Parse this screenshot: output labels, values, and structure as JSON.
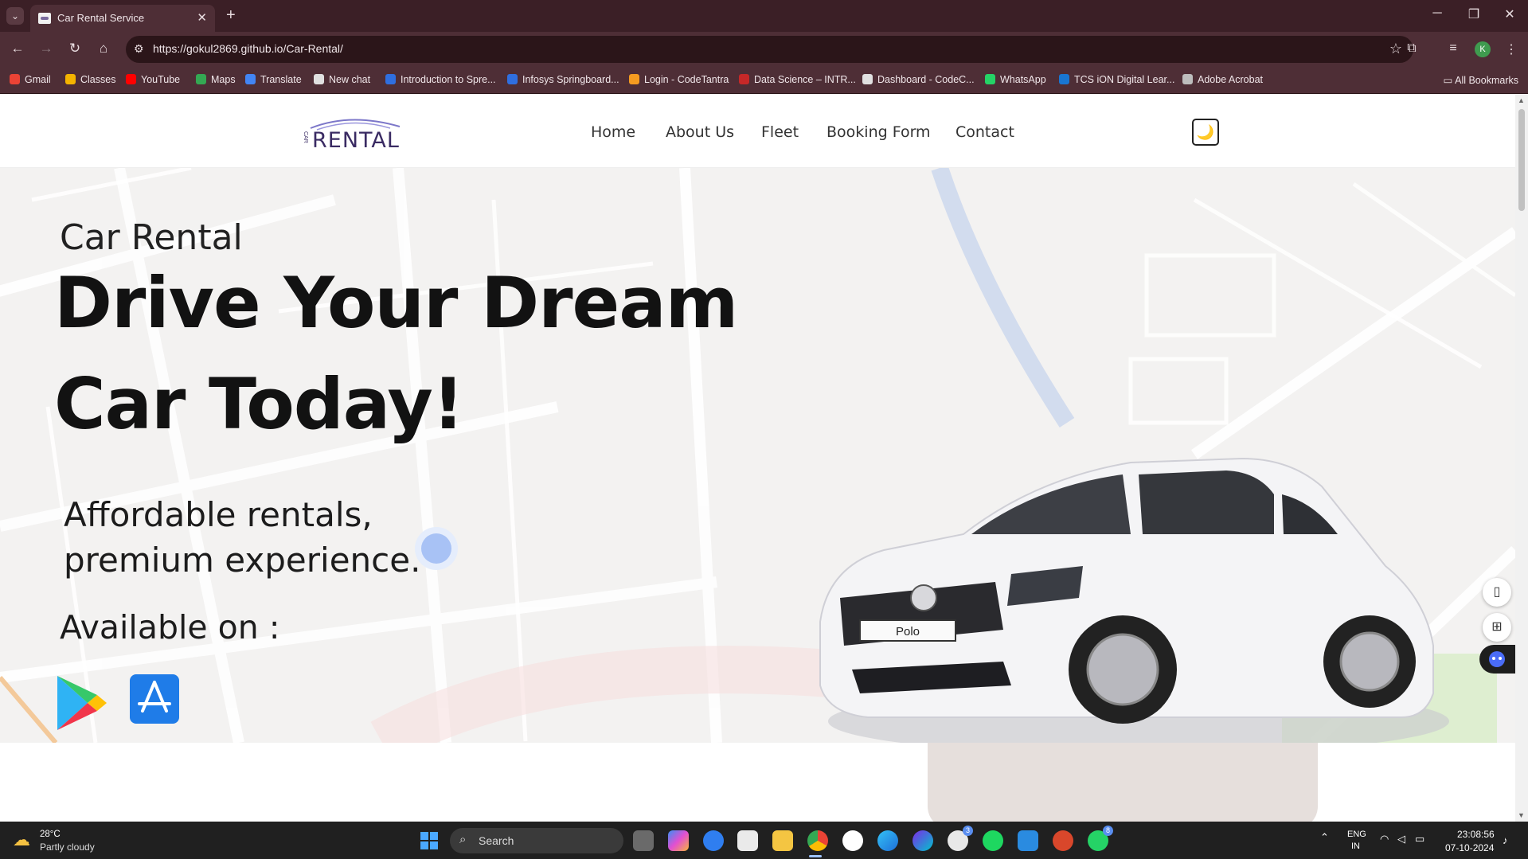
{
  "browser": {
    "tab_title": "Car Rental Service",
    "url": "https://gokul2869.github.io/Car-Rental/",
    "profile_initial": "K",
    "bookmarks": [
      {
        "label": "Gmail",
        "color": "#ea4335"
      },
      {
        "label": "Classes",
        "color": "#f4b400"
      },
      {
        "label": "YouTube",
        "color": "#ff0000"
      },
      {
        "label": "Maps",
        "color": "#34a853"
      },
      {
        "label": "Translate",
        "color": "#4285f4"
      },
      {
        "label": "New chat",
        "color": "#e0e0e0"
      },
      {
        "label": "Introduction to Spre...",
        "color": "#2f6fe0"
      },
      {
        "label": "Infosys Springboard...",
        "color": "#2f6fe0"
      },
      {
        "label": "Login - CodeTantra",
        "color": "#f59b20"
      },
      {
        "label": "Data Science – INTR...",
        "color": "#c62828"
      },
      {
        "label": "Dashboard - CodeC...",
        "color": "#e0e0e0"
      },
      {
        "label": "WhatsApp",
        "color": "#25d366"
      },
      {
        "label": "TCS iON Digital Lear...",
        "color": "#1976d2"
      },
      {
        "label": "Adobe Acrobat",
        "color": "#bdbdbd"
      }
    ],
    "all_bookmarks": "All Bookmarks"
  },
  "site": {
    "logo_text": "RENTAL",
    "logo_small": "CAR",
    "nav": [
      "Home",
      "About Us",
      "Fleet",
      "Booking Form",
      "Contact"
    ],
    "theme_icon": "🌙"
  },
  "hero": {
    "eyebrow": "Car Rental",
    "headline_line1": "Drive Your Dream",
    "headline_line2": "Car Today!",
    "tagline_line1": "Affordable rentals,",
    "tagline_line2": "premium experience.",
    "available_on": "Available on :",
    "car_plate": "Polo"
  },
  "taskbar": {
    "weather_temp": "28°C",
    "weather_desc": "Partly cloudy",
    "search_placeholder": "Search",
    "lang_line1": "ENG",
    "lang_line2": "IN",
    "time": "23:08:56",
    "date": "07-10-2024",
    "whatsapp_badge": "3",
    "whatsapp2_badge": "8"
  },
  "colors": {
    "chrome_dark": "#3b1f26",
    "chrome_mid": "#4e2e36",
    "hero_bg": "#f3f2f1",
    "car_panel": "#e6dfdc",
    "accent_dot": "#a8c2f5"
  }
}
